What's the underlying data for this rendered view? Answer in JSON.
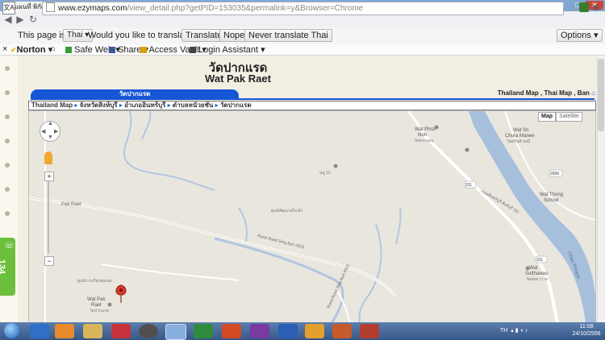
{
  "browser": {
    "tab_title": "แผนที่ พิกัดวัดปากแรด อำเภ...",
    "url_host": "www.ezymaps.com",
    "url_rest": "/view_detail.php?getPID=153035&permalink=y&Browser=Chrome"
  },
  "translate_bar": {
    "prefix": "This page is in",
    "language": "Thai",
    "question": "Would you like to translate it?",
    "translate_btn": "Translate",
    "nope_btn": "Nope",
    "never_btn": "Never translate Thai",
    "options_btn": "Options"
  },
  "norton_bar": {
    "norton": "Norton",
    "safe_web": "Safe Web",
    "share": "Share",
    "access_vault": "Access Vault",
    "login_assistant": "Login Assistant"
  },
  "page": {
    "title_th": "วัดปากแรด",
    "title_en": "Wat Pak Raet",
    "blue_tab": "วัดปากแรด",
    "right_links": "Thailand Map , Thai Map , Ban",
    "badge_number": "134",
    "breadcrumb": [
      "Thailand Map",
      "จังหวัดสิงห์บุรี",
      "อำเภออินทร์บุรี",
      "ตำบลหนัวยชัน",
      "วัดปากแรด"
    ]
  },
  "map": {
    "map_btn": "Map",
    "satellite_btn": "Satellite",
    "labels": {
      "wat_phra_non": "Wat Phra",
      "wat_phra_non2": "Non",
      "wat_phra_non_th": "วัดพระนอน",
      "wat_sri": "Wat Sri",
      "wat_sri2": "Chura Manee",
      "wat_sri_th": "วัดศรีจุฬามณี",
      "wat_thong": "Wat Thong",
      "wat_thong2": "School",
      "wat_sutthawas": "Wat",
      "wat_sutthawas2": "Sutthawas",
      "wat_sutthawas_th": "วัดสุทธาวาส",
      "wat_pak_raet": "Wat Pak",
      "wat_pak_raet2": "Raet",
      "wat_pak_raet_th": "วัดปากแรด",
      "pak_raet_road": "Pak Raet",
      "rural_road": "Rural Road Sing Buri 4023",
      "road_bottom": "Rural Road Sing Buri 4023",
      "chao_phraya": "Chao Phraya",
      "route_311": "311",
      "route_2006": "2006",
      "route_311b": "311",
      "highway_text": "ถนนอินทร์บุรี-สิงห์บุรี 311",
      "poi_center": "หมู่ 12",
      "poi_school": "ศูนย์พัฒนาเด็กเล็ก",
      "poi_left": "ศูนย์การเรียนชุมชน"
    },
    "zoom_in": "+",
    "zoom_out": "−"
  },
  "taskbar": {
    "lang": "TH",
    "time": "11:08",
    "date": "24/10/2556"
  },
  "colors": {
    "accent_blue": "#1556d6",
    "river": "#a6bfdd",
    "map_bg": "#e9e6de"
  }
}
